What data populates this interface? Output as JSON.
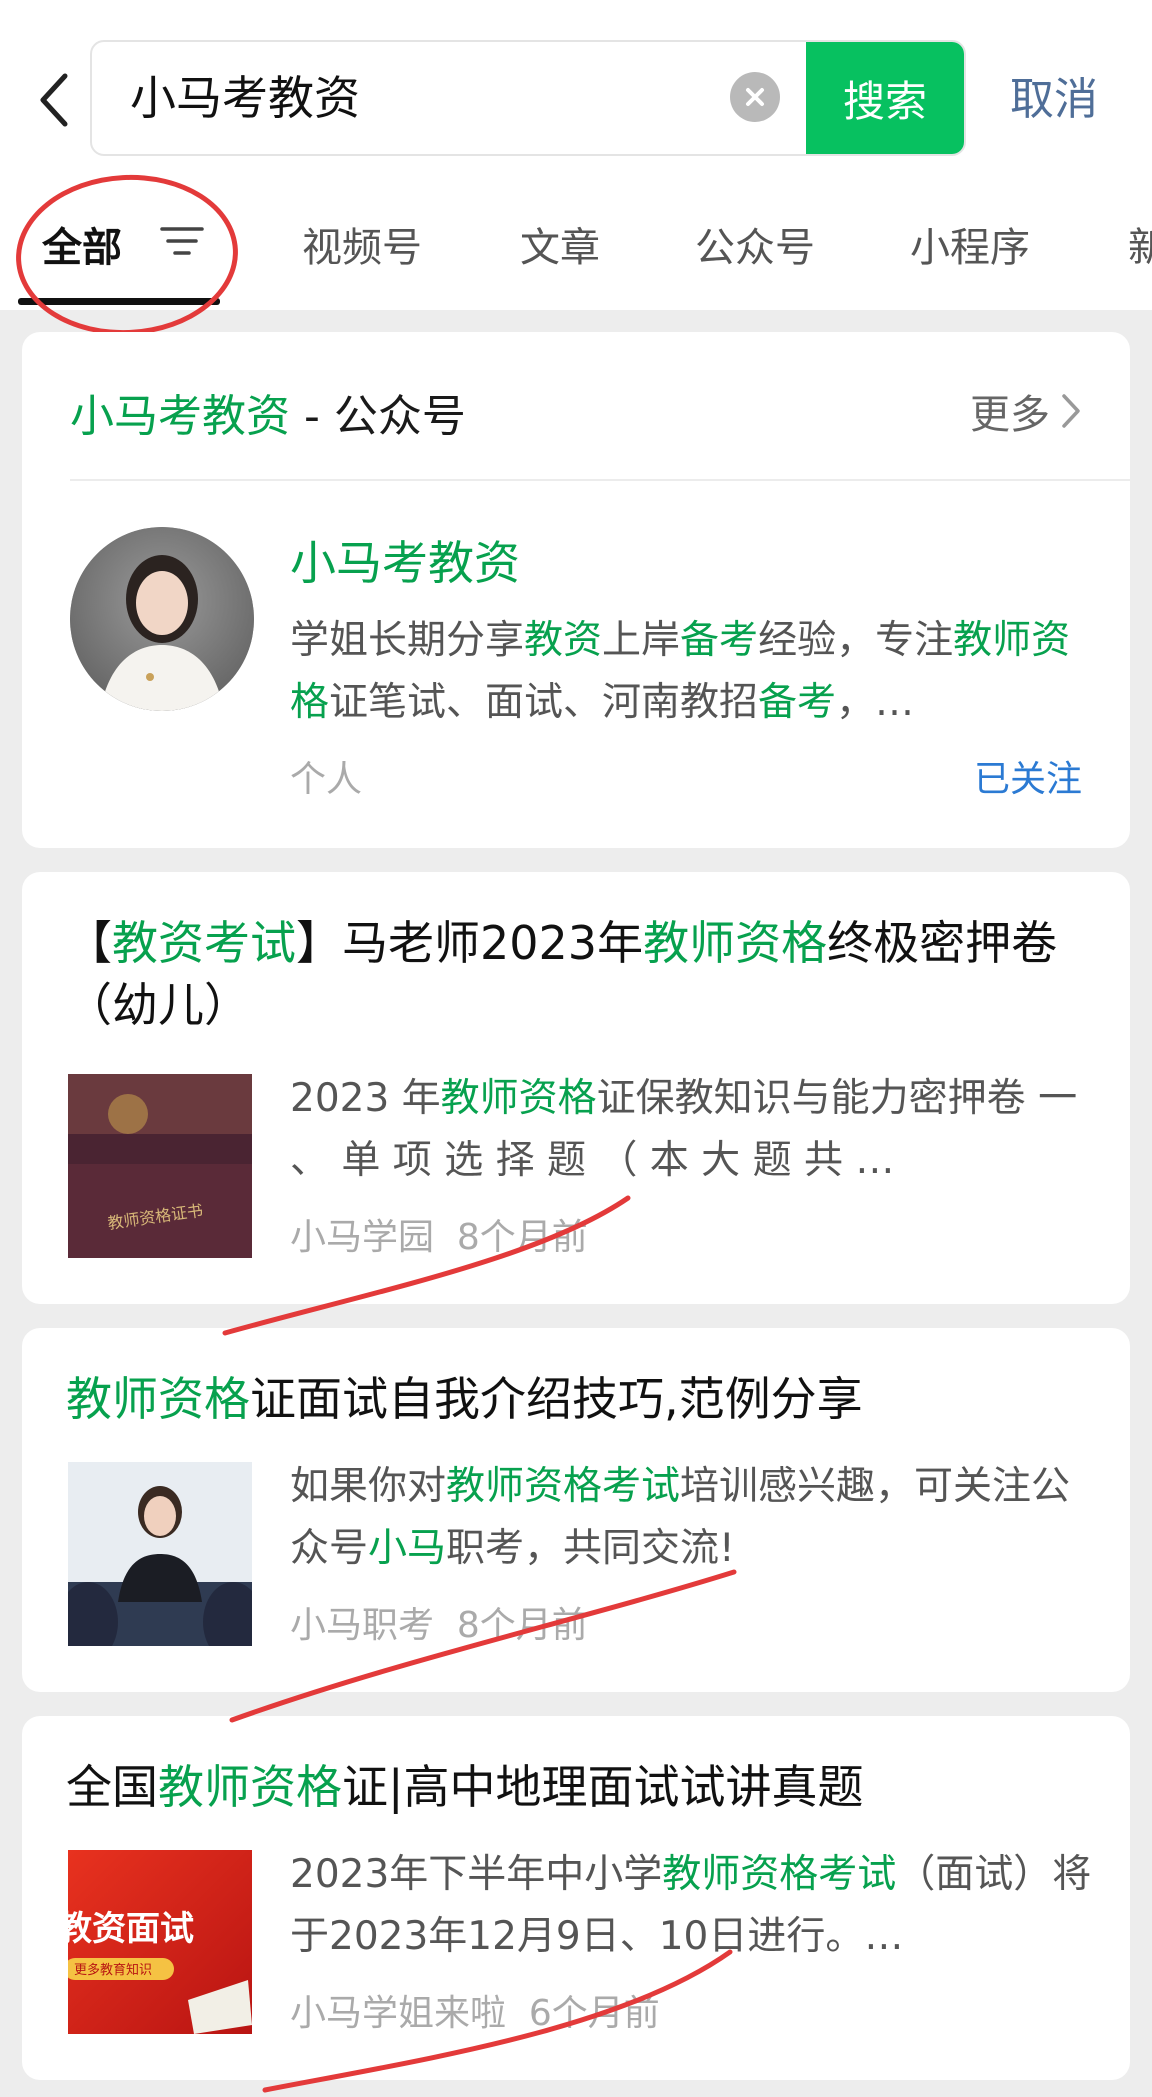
{
  "search": {
    "query": "小马考教资",
    "search_label": "搜索",
    "cancel_label": "取消"
  },
  "tabs": [
    {
      "label": "全部",
      "active": true
    },
    {
      "label": "视频号"
    },
    {
      "label": "文章"
    },
    {
      "label": "公众号"
    },
    {
      "label": "小程序"
    },
    {
      "label": "新"
    }
  ],
  "account_card": {
    "header_name": "小马考教资",
    "header_sep": " - ",
    "header_type": "公众号",
    "more_label": "更多",
    "name": "小马考教资",
    "desc_parts": [
      {
        "t": "学姐长期分享",
        "h": false
      },
      {
        "t": "教资",
        "h": true
      },
      {
        "t": "上岸",
        "h": false
      },
      {
        "t": "备考",
        "h": true
      },
      {
        "t": "经验，专注",
        "h": false
      },
      {
        "t": "教师资格",
        "h": true
      },
      {
        "t": "证笔试、面试、河南教招",
        "h": false
      },
      {
        "t": "备考",
        "h": true
      },
      {
        "t": "，…",
        "h": false
      }
    ],
    "type_label": "个人",
    "follow_label": "已关注"
  },
  "articles": [
    {
      "title_parts": [
        {
          "t": "【",
          "h": false
        },
        {
          "t": "教资考试",
          "h": true
        },
        {
          "t": "】马老师2023年",
          "h": false
        },
        {
          "t": "教师资格",
          "h": true
        },
        {
          "t": "终极密押卷（幼儿）",
          "h": false
        }
      ],
      "desc_parts": [
        {
          "t": "2023 年",
          "h": false
        },
        {
          "t": "教师资格",
          "h": true
        },
        {
          "t": "证保教知识与能力密押卷 一 、 单 项 选 择 题 （ 本 大 题 共 …",
          "h": false
        }
      ],
      "source": "小马学园",
      "time": "8个月前",
      "thumb_text": "教师资格证书"
    },
    {
      "title_parts": [
        {
          "t": "教师资格",
          "h": true
        },
        {
          "t": "证面试自我介绍技巧,范例分享",
          "h": false
        }
      ],
      "desc_parts": [
        {
          "t": "如果你对",
          "h": false
        },
        {
          "t": "教师资格考试",
          "h": true
        },
        {
          "t": "培训感兴趣，可关注公众号",
          "h": false
        },
        {
          "t": "小马",
          "h": true
        },
        {
          "t": "职考，共同交流!",
          "h": false
        }
      ],
      "source": "小马职考",
      "time": "8个月前"
    },
    {
      "title_parts": [
        {
          "t": "全国",
          "h": false
        },
        {
          "t": "教师资格",
          "h": true
        },
        {
          "t": "证|高中地理面试试讲真题",
          "h": false
        }
      ],
      "desc_parts": [
        {
          "t": "2023年下半年中小学",
          "h": false
        },
        {
          "t": "教师资格考试",
          "h": true
        },
        {
          "t": "（面试）将于2023年12月9日、10日进行。…",
          "h": false
        }
      ],
      "source": "小马学姐来啦",
      "time": "6个月前",
      "thumb_text": "教资面试",
      "thumb_sub": "更多教育知识"
    }
  ],
  "colors": {
    "accent_green": "#07c160",
    "highlight_green": "#07a14e",
    "link_blue": "#2b7ad3",
    "annotation_red": "#e33a3a"
  },
  "icons": [
    "back-arrow-icon",
    "clear-icon",
    "filter-icon",
    "chevron-right-icon"
  ]
}
